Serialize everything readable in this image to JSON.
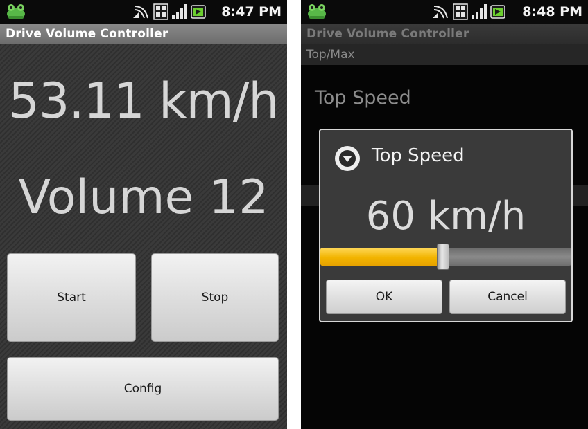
{
  "left": {
    "status_bar": {
      "time": "8:47 PM",
      "icons": [
        "frog-icon",
        "wifi-icon",
        "3g-icon",
        "signal-icon",
        "battery-icon"
      ]
    },
    "title": "Drive Volume Controller",
    "speed": "53.11 km/h",
    "volume": "Volume 12",
    "buttons": {
      "start": "Start",
      "stop": "Stop",
      "config": "Config"
    }
  },
  "right": {
    "status_bar": {
      "time": "8:48 PM",
      "icons": [
        "frog-icon",
        "wifi-icon",
        "3g-icon",
        "signal-icon",
        "battery-icon"
      ]
    },
    "title": "Drive Volume Controller",
    "section_header": "Top/Max",
    "pref_top_speed": "Top Speed",
    "dialog": {
      "title": "Top Speed",
      "icon": "chevron-down-icon",
      "value": "60 km/h",
      "slider_fraction": 0.49,
      "ok_label": "OK",
      "cancel_label": "Cancel"
    }
  },
  "colors": {
    "accent": "#f2b400",
    "background_dark": "#050505",
    "button_light": "#dcdcdc"
  }
}
